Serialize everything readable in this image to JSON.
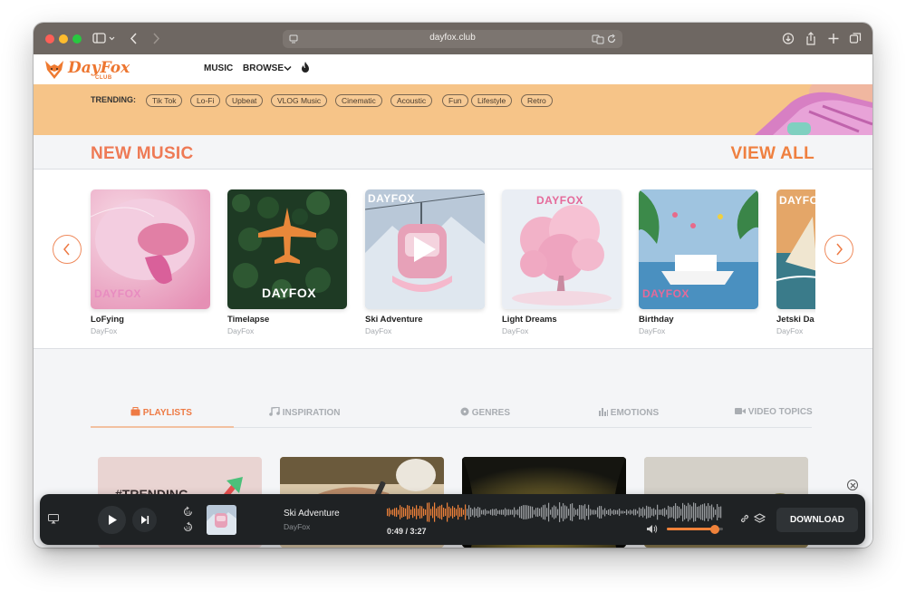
{
  "browser": {
    "url": "dayfox.club"
  },
  "nav": {
    "logo_text": "DayFox",
    "logo_sub": "CLUB",
    "links": [
      "MUSIC",
      "BROWSE"
    ]
  },
  "trending": {
    "label": "TRENDING:",
    "tags": [
      "Tik Tok",
      "Lo-Fi",
      "Upbeat",
      "VLOG Music",
      "Cinematic",
      "Acoustic",
      "Fun",
      "Lifestyle",
      "Retro"
    ]
  },
  "new_music": {
    "title": "NEW MUSIC",
    "view_all": "VIEW ALL",
    "brand": "DAYFOX",
    "items": [
      {
        "title": "LoFying",
        "artist": "DayFox"
      },
      {
        "title": "Timelapse",
        "artist": "DayFox"
      },
      {
        "title": "Ski Adventure",
        "artist": "DayFox"
      },
      {
        "title": "Light Dreams",
        "artist": "DayFox"
      },
      {
        "title": "Birthday",
        "artist": "DayFox"
      },
      {
        "title": "Jetski Da",
        "artist": "DayFox"
      }
    ]
  },
  "tabs": [
    "PLAYLISTS",
    "INSPIRATION",
    "GENRES",
    "EMOTIONS",
    "VIDEO TOPICS"
  ],
  "playlists": {
    "first_label": "#TRENDING"
  },
  "player": {
    "track_title": "Ski Adventure",
    "track_artist": "DayFox",
    "time": "0:49 / 3:27",
    "progress": 0.237,
    "volume": 0.85,
    "download_label": "DOWNLOAD"
  },
  "colors": {
    "accent": "#ee7a55",
    "trending_bg": "#f6c488",
    "player_bg": "#1f2224",
    "waveform_played": "#f0823a",
    "waveform_rest": "#9a9da0"
  }
}
